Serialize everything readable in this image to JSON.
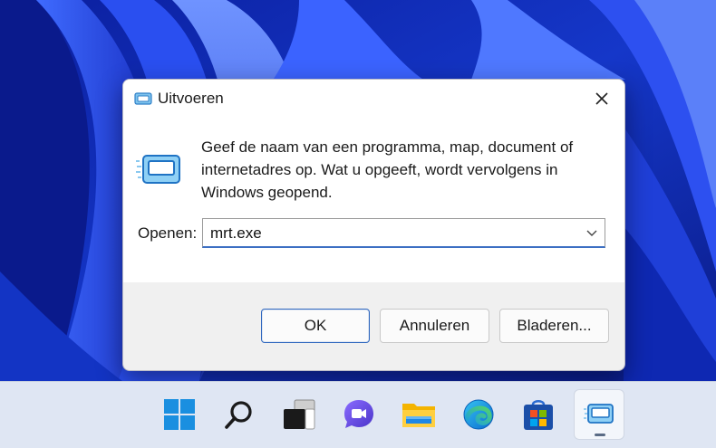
{
  "dialog": {
    "title": "Uitvoeren",
    "description": "Geef de naam van een programma, map, document of internetadres op. Wat u opgeeft, wordt vervolgens in Windows geopend.",
    "open_label": "Openen:",
    "open_value": "mrt.exe",
    "buttons": {
      "ok": "OK",
      "cancel": "Annuleren",
      "browse": "Bladeren..."
    },
    "icons": {
      "title": "run-icon",
      "close": "close-icon",
      "main": "run-icon",
      "dropdown": "chevron-down-icon"
    }
  },
  "taskbar": {
    "items": [
      {
        "icon": "windows-start-icon"
      },
      {
        "icon": "search-icon"
      },
      {
        "icon": "task-view-icon"
      },
      {
        "icon": "chat-icon"
      },
      {
        "icon": "file-explorer-icon"
      },
      {
        "icon": "edge-icon"
      },
      {
        "icon": "store-icon"
      },
      {
        "icon": "run-icon",
        "active": true
      }
    ]
  },
  "colors": {
    "accent": "#2f67bf",
    "wallpaper": "#1a3fd6",
    "taskbar": "#dfe6f3"
  }
}
